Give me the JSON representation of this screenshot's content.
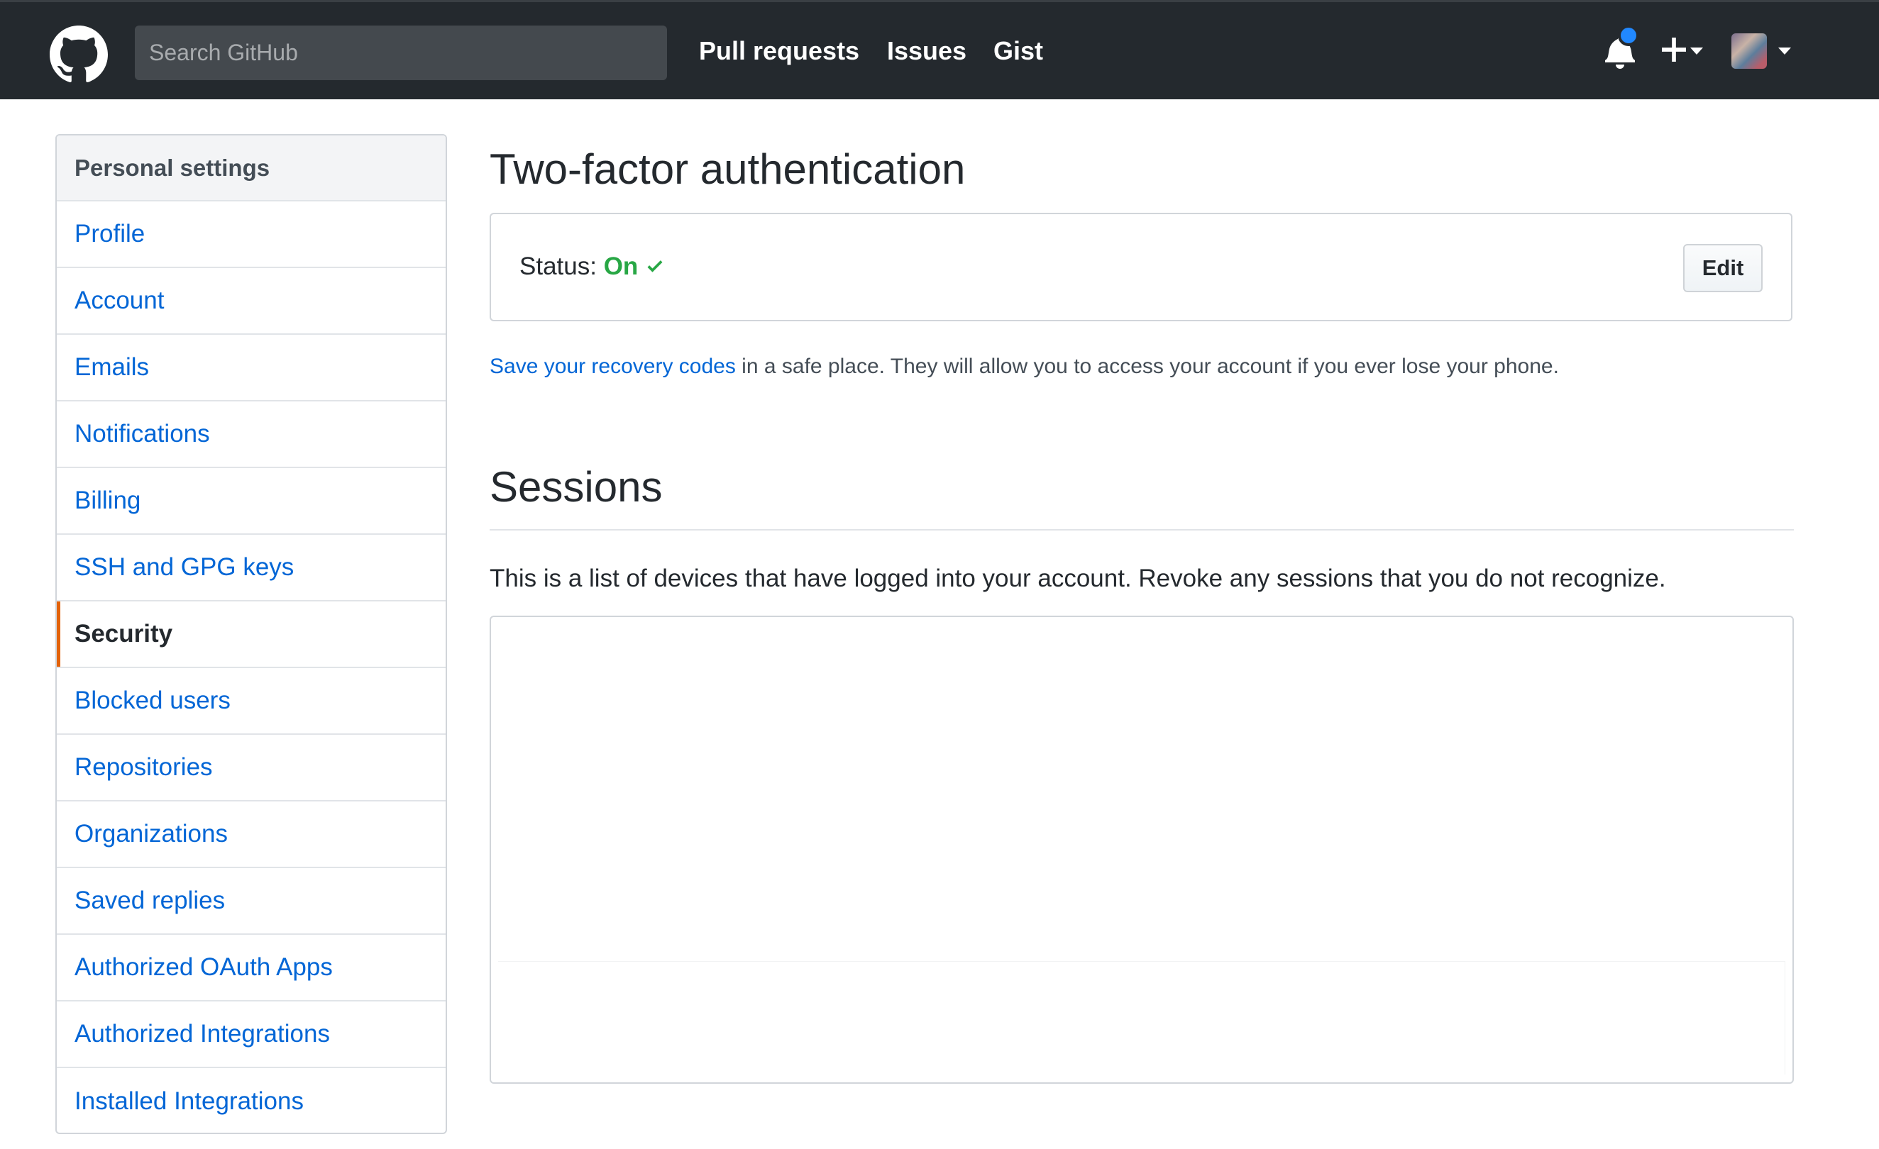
{
  "header": {
    "search_placeholder": "Search GitHub",
    "nav": {
      "pull_requests": "Pull requests",
      "issues": "Issues",
      "gist": "Gist"
    },
    "icons": [
      "github-logo-icon",
      "bell-icon",
      "plus-icon",
      "chevron-down-icon",
      "avatar"
    ],
    "notification_dot_color": "#2188ff"
  },
  "sidebar": {
    "title": "Personal settings",
    "items": [
      {
        "label": "Profile",
        "selected": false
      },
      {
        "label": "Account",
        "selected": false
      },
      {
        "label": "Emails",
        "selected": false
      },
      {
        "label": "Notifications",
        "selected": false
      },
      {
        "label": "Billing",
        "selected": false
      },
      {
        "label": "SSH and GPG keys",
        "selected": false
      },
      {
        "label": "Security",
        "selected": true
      },
      {
        "label": "Blocked users",
        "selected": false
      },
      {
        "label": "Repositories",
        "selected": false
      },
      {
        "label": "Organizations",
        "selected": false
      },
      {
        "label": "Saved replies",
        "selected": false
      },
      {
        "label": "Authorized OAuth Apps",
        "selected": false
      },
      {
        "label": "Authorized Integrations",
        "selected": false
      },
      {
        "label": "Installed Integrations",
        "selected": false
      }
    ],
    "selected_accent_color": "#e36209"
  },
  "two_factor": {
    "heading": "Two-factor authentication",
    "status_label": "Status:",
    "status_value": "On",
    "status_color": "#28a745",
    "edit_label": "Edit",
    "recovery_link": "Save your recovery codes",
    "recovery_text": " in a safe place. They will allow you to access your account if you ever lose your phone."
  },
  "sessions": {
    "heading": "Sessions",
    "description": "This is a list of devices that have logged into your account. Revoke any sessions that you do not recognize."
  },
  "colors": {
    "header_bg": "#24292e",
    "link": "#0366d6"
  }
}
